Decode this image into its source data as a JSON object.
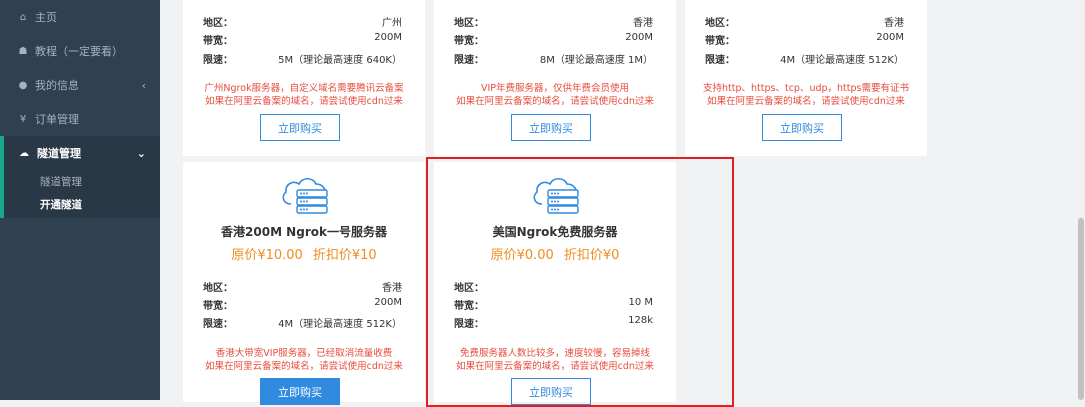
{
  "sidebar": {
    "items": [
      {
        "icon": "home-icon",
        "glyph": "⌂",
        "label": "主页"
      },
      {
        "icon": "mortarboard-icon",
        "glyph": "☗",
        "label": "教程（一定要看）"
      },
      {
        "icon": "user-icon",
        "glyph": "●",
        "label": "我的信息",
        "arrow": "‹"
      },
      {
        "icon": "yen-icon",
        "glyph": "¥",
        "label": "订单管理"
      }
    ],
    "active": {
      "icon": "cloud-icon",
      "glyph": "☁",
      "label": "隧道管理",
      "arrow": "⌄"
    },
    "subitems": [
      {
        "label": "隧道管理"
      },
      {
        "label": "开通隧道"
      }
    ]
  },
  "labels": {
    "region": "地区：",
    "bandwidth": "带宽：",
    "speed": "限速：",
    "buy": "立即购买"
  },
  "top_cards": [
    {
      "region": "广州",
      "bandwidth": "200M",
      "speed": "5M（理论最高速度 640K）",
      "desc1": "广州Ngrok服务器，自定义域名需要腾讯云备案",
      "desc2": "如果在阿里云备案的域名，请尝试使用cdn过来"
    },
    {
      "region": "香港",
      "bandwidth": "200M",
      "speed": "8M（理论最高速度 1M）",
      "desc1": "VIP年费服务器，仅供年费会员使用",
      "desc2": "如果在阿里云备案的域名，请尝试使用cdn过来"
    },
    {
      "region": "香港",
      "bandwidth": "200M",
      "speed": "4M（理论最高速度 512K）",
      "desc1": "支持http、https、tcp、udp，https需要有证书",
      "desc2": "如果在阿里云备案的域名，请尝试使用cdn过来"
    }
  ],
  "bottom_cards": [
    {
      "title": "香港200M Ngrok一号服务器",
      "orig_price": "原价¥10.00",
      "discount_price": "折扣价¥10",
      "region": "香港",
      "bandwidth": "200M",
      "speed": "4M（理论最高速度 512K）",
      "desc1": "香港大带宽VIP服务器，已经取消流量收费",
      "desc2": "如果在阿里云备案的域名，请尝试使用cdn过来"
    },
    {
      "title": "美国Ngrok免费服务器",
      "orig_price": "原价¥0.00",
      "discount_price": "折扣价¥0",
      "region": "",
      "bandwidth": "10 M",
      "speed": "128k",
      "desc1": "免费服务器人数比较多，速度较慢，容易掉线",
      "desc2": "如果在阿里云备案的域名，请尝试使用cdn过来"
    }
  ],
  "colors": {
    "sidebar": "#2f4050",
    "accent": "#2f8ae0",
    "price": "#f08c1e",
    "warning": "#e74c3c",
    "highlight": "#e02020"
  }
}
